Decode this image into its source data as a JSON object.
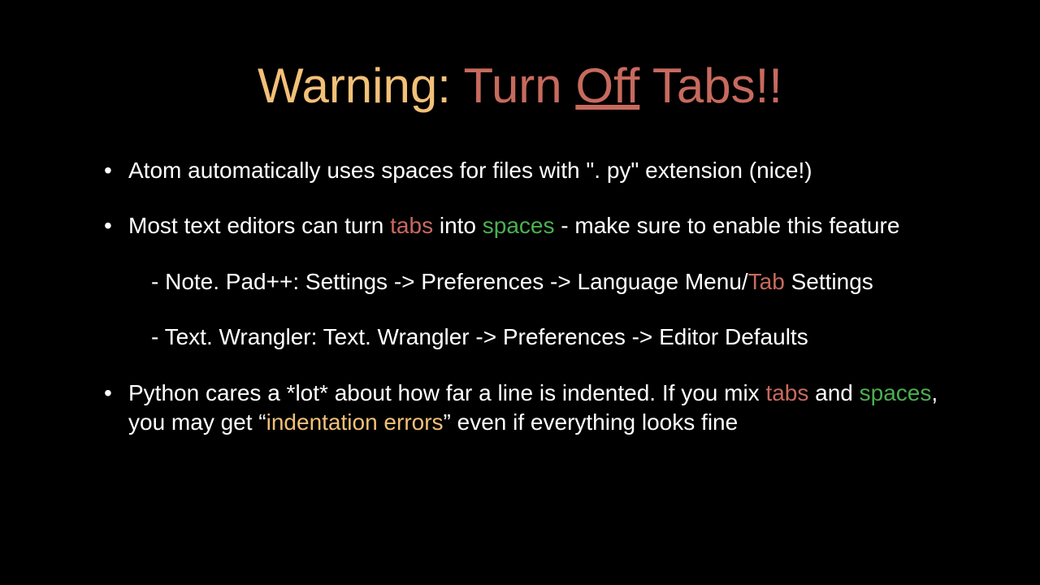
{
  "title": {
    "warning": "Warning:",
    "turn": "Turn",
    "off": "Off",
    "tabs": "Tabs!!"
  },
  "bullets": {
    "b1": "Atom automatically uses spaces for files with \". py\" extension (nice!)",
    "b2_pre": "Most text editors can turn ",
    "b2_tabs": "tabs",
    "b2_mid": " into ",
    "b2_spaces": "spaces",
    "b2_post": " - make sure to enable this feature",
    "b2_sub1_pre": "-  Note. Pad++:  Settings -> Preferences -> Language Menu/",
    "b2_sub1_tab": "Tab",
    "b2_sub1_post": " Settings",
    "b2_sub2": "-  Text. Wrangler:  Text. Wrangler -> Preferences -> Editor Defaults",
    "b3_pre": "Python cares a *lot* about how far a line is indented.  If you mix ",
    "b3_tabs": "tabs",
    "b3_mid": " and ",
    "b3_spaces": "spaces",
    "b3_mid2": ", you may get “",
    "b3_err": "indentation errors",
    "b3_post": "” even if everything looks fine"
  }
}
